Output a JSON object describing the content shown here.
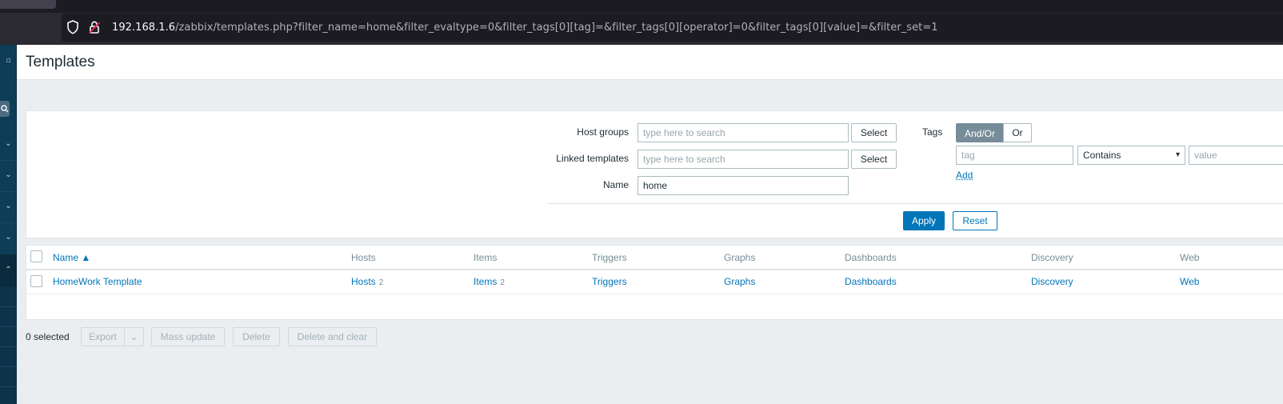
{
  "browser": {
    "url_host": "192.168.1.6",
    "url_path": "/zabbix/templates.php?filter_name=home&filter_evaltype=0&filter_tags[0][tag]=&filter_tags[0][operator]=0&filter_tags[0][value]=&filter_set=1"
  },
  "sidebar": {
    "items": [
      {
        "icon": "chevron-down-icon",
        "glyph": "⌄"
      },
      {
        "icon": "chevron-down-icon",
        "glyph": "⌄"
      },
      {
        "icon": "chevron-down-icon",
        "glyph": "⌄"
      },
      {
        "icon": "chevron-down-icon",
        "glyph": "⌄"
      },
      {
        "icon": "chevron-up-icon",
        "glyph": "⌃"
      }
    ]
  },
  "header": {
    "title": "Templates"
  },
  "filter": {
    "host_groups_label": "Host groups",
    "host_groups_placeholder": "type here to search",
    "linked_templates_label": "Linked templates",
    "linked_templates_placeholder": "type here to search",
    "name_label": "Name",
    "name_value": "home",
    "select_label": "Select",
    "tags_label": "Tags",
    "tags_andor": "And/Or",
    "tags_or": "Or",
    "tag_placeholder": "tag",
    "operator_value": "Contains",
    "value_placeholder": "value",
    "add_label": "Add",
    "apply_label": "Apply",
    "reset_label": "Reset"
  },
  "table": {
    "headers": {
      "name": "Name ▲",
      "hosts": "Hosts",
      "items": "Items",
      "triggers": "Triggers",
      "graphs": "Graphs",
      "dashboards": "Dashboards",
      "discovery": "Discovery",
      "web": "Web"
    },
    "rows": [
      {
        "name": "HomeWork Template",
        "hosts": "Hosts",
        "hosts_count": "2",
        "items": "Items",
        "items_count": "2",
        "triggers": "Triggers",
        "graphs": "Graphs",
        "dashboards": "Dashboards",
        "discovery": "Discovery",
        "web": "Web"
      }
    ]
  },
  "actions": {
    "selected": "0 selected",
    "export": "Export",
    "export_dropdown": "⌄",
    "mass_update": "Mass update",
    "delete": "Delete",
    "delete_and_clear": "Delete and clear"
  },
  "colors": {
    "link": "#0275b8",
    "sidebar": "#0e3d58",
    "page_bg": "#ebeef0"
  }
}
